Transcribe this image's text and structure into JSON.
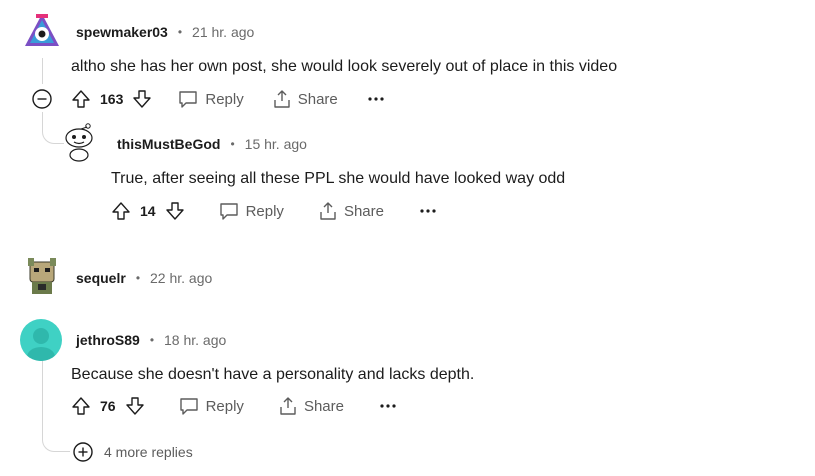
{
  "comments": [
    {
      "username": "spewmaker03",
      "time": "21 hr. ago",
      "text": "altho she has her own post, she would look severely out of place in this video",
      "votes": "163",
      "reply_label": "Reply",
      "share_label": "Share"
    },
    {
      "username": "thisMustBeGod",
      "time": "15 hr. ago",
      "text": "True, after seeing all these PPL she would have looked way odd",
      "votes": "14",
      "reply_label": "Reply",
      "share_label": "Share"
    },
    {
      "username": "sequelr",
      "time": "22 hr. ago"
    },
    {
      "username": "jethroS89",
      "time": "18 hr. ago",
      "text": "Because she doesn't have a personality and lacks depth.",
      "votes": "76",
      "reply_label": "Reply",
      "share_label": "Share"
    }
  ],
  "separator": "•",
  "more_replies": "4 more replies",
  "colors": {
    "thread_line": "#d6d6d6",
    "muted_text": "#6a6a6a",
    "avatar_teal": "#3fd1c4"
  }
}
